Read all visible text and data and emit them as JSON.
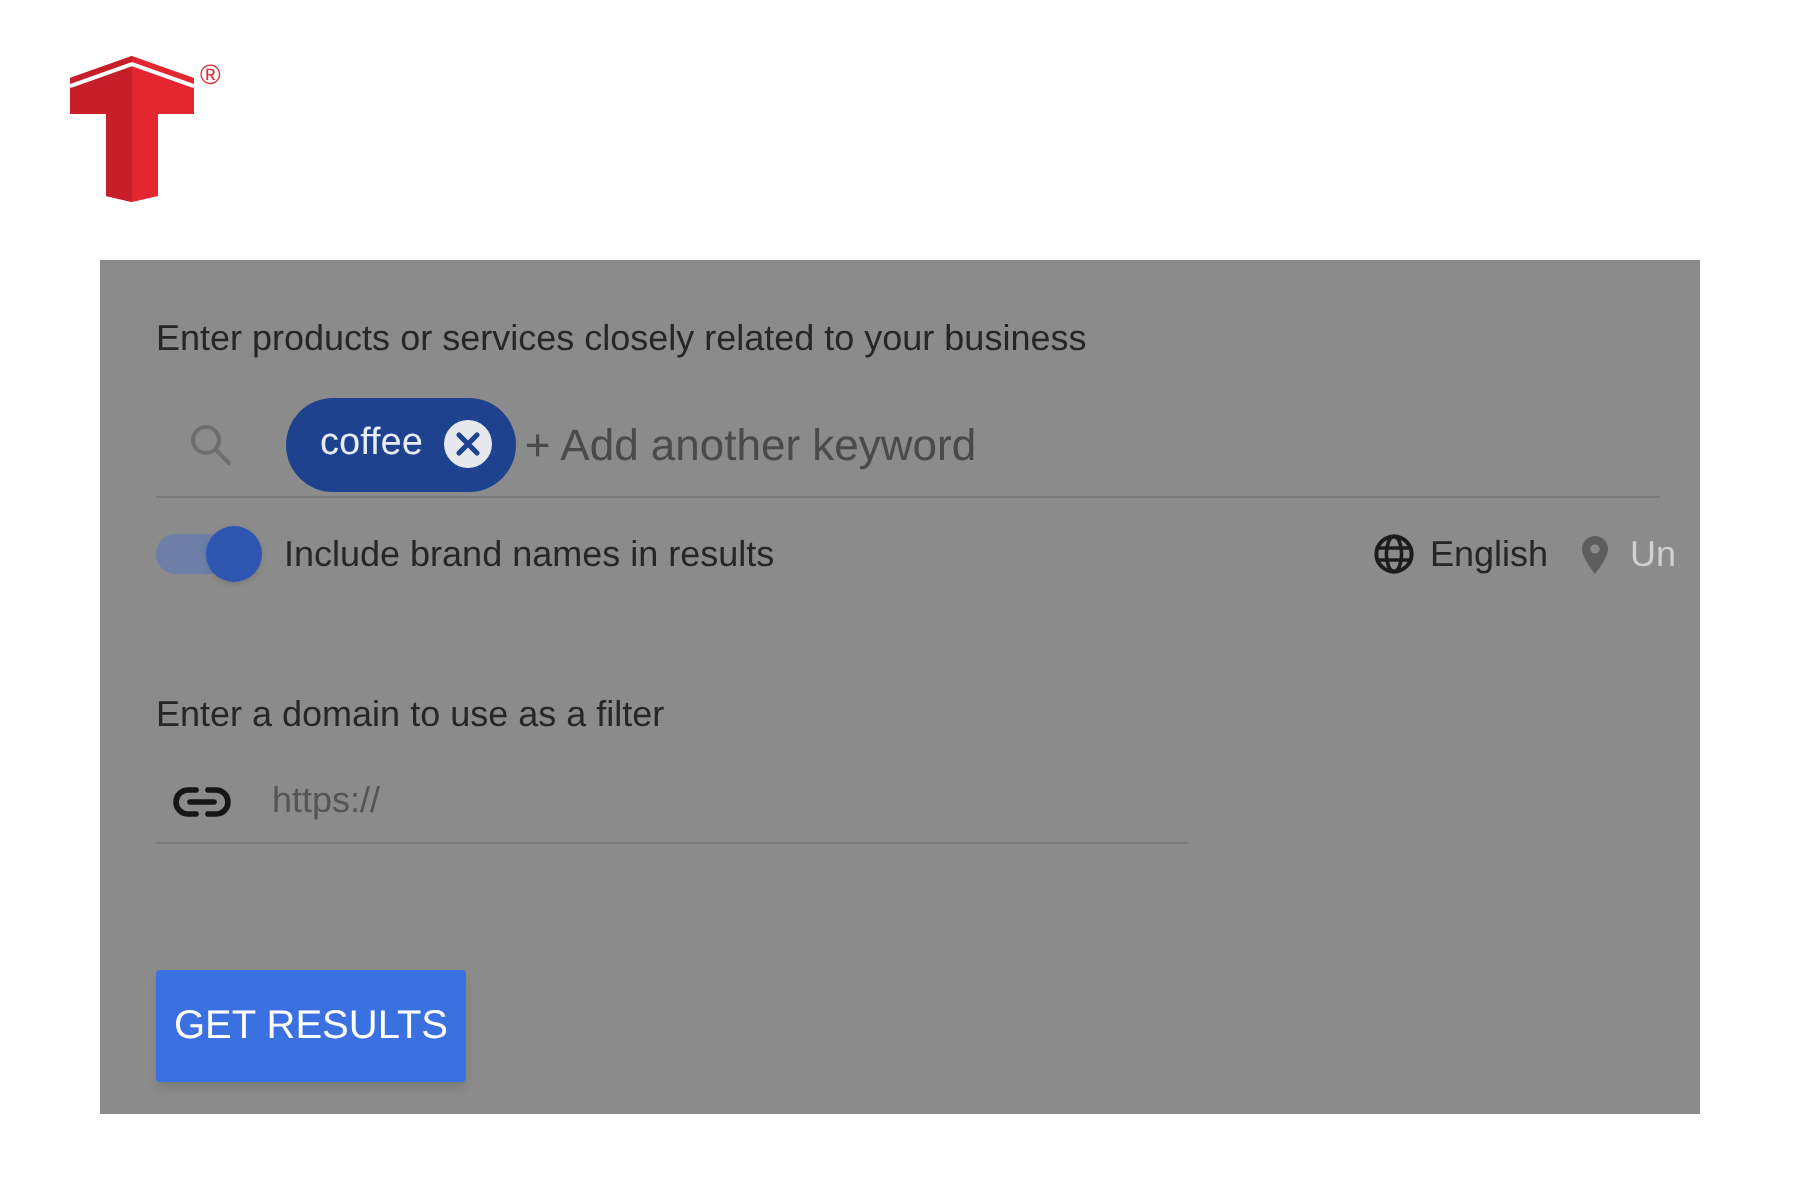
{
  "logo": {
    "mark": "®"
  },
  "keywords_section": {
    "label": "Enter products or services closely related to your business",
    "keywords": [
      {
        "text": "coffee"
      }
    ],
    "placeholder": "+ Add another keyword"
  },
  "brand_toggle": {
    "label": "Include brand names in results",
    "on": true
  },
  "language": "English",
  "location": "Un",
  "domain_section": {
    "label": "Enter a domain to use as a filter",
    "placeholder": "https://"
  },
  "button": "GET RESULTS"
}
